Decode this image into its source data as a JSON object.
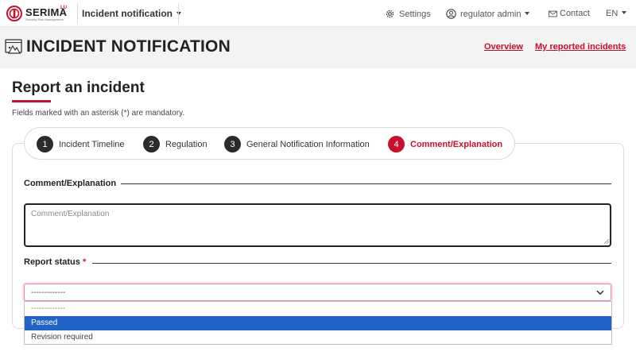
{
  "brand": {
    "name": "SERIMA",
    "superscript": "LU",
    "tagline": "Security Risk Management"
  },
  "nav": {
    "module": "Incident notification",
    "settings": "Settings",
    "user": "regulator admin",
    "contact": "Contact",
    "language": "EN"
  },
  "header": {
    "title": "INCIDENT NOTIFICATION",
    "links": {
      "overview": "Overview",
      "my_reports": "My reported incidents"
    }
  },
  "page": {
    "title": "Report an incident",
    "mandatory_note": "Fields marked with an asterisk (*) are mandatory."
  },
  "steps": [
    {
      "num": "1",
      "label": "Incident Timeline"
    },
    {
      "num": "2",
      "label": "Regulation"
    },
    {
      "num": "3",
      "label": "General Notification Information"
    },
    {
      "num": "4",
      "label": "Comment/Explanation"
    }
  ],
  "active_step": 4,
  "form": {
    "comment": {
      "section": "Comment/Explanation",
      "placeholder": "Comment/Explanation",
      "value": ""
    },
    "status": {
      "section": "Report status",
      "required_mark": "*",
      "selected": "-------------",
      "options": [
        "-------------",
        "Passed",
        "Revision required"
      ],
      "highlighted_option": "Passed"
    }
  },
  "colors": {
    "accent": "#c8102e",
    "highlight": "#1f63c7",
    "header_bg": "#f3f3f3"
  }
}
